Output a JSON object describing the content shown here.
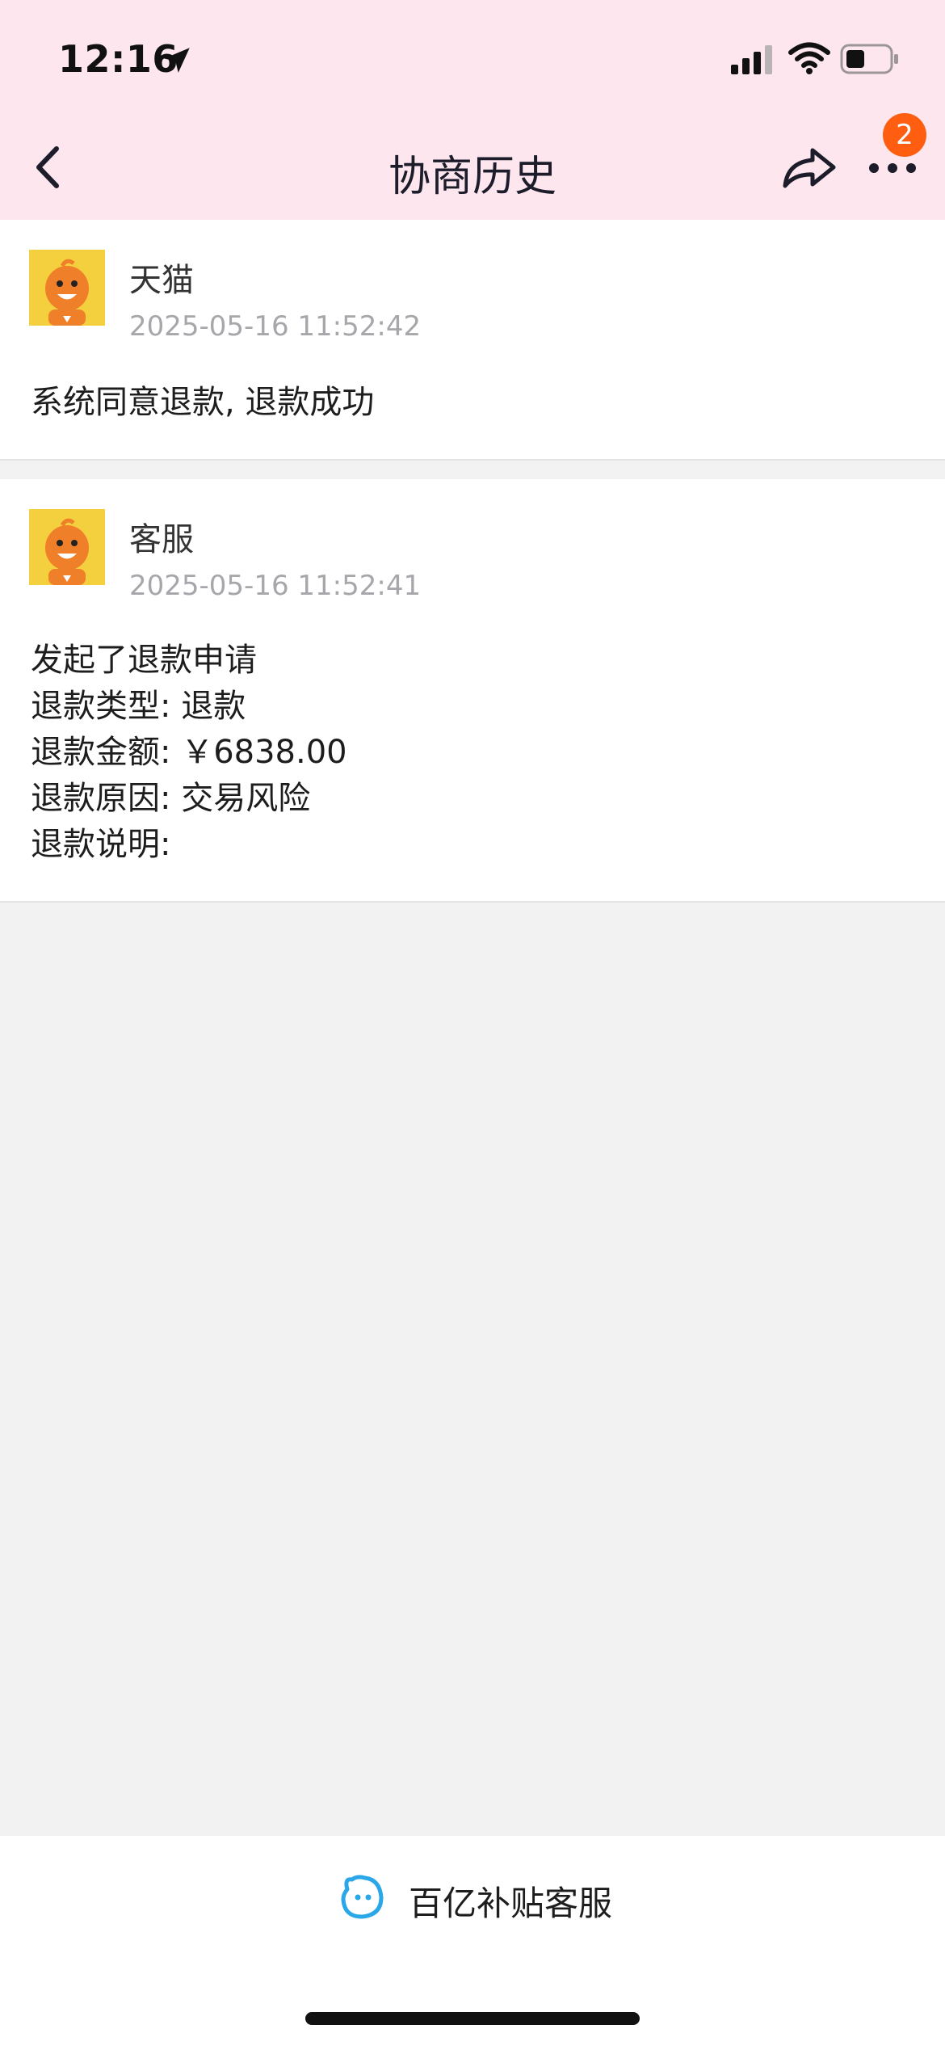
{
  "status_bar": {
    "time": "12:16",
    "icons": [
      "location-arrow-icon",
      "signal-icon",
      "wifi-icon",
      "battery-icon"
    ]
  },
  "nav": {
    "title": "协商历史",
    "badge_count": "2",
    "icons": [
      "back-icon",
      "share-icon",
      "more-icon"
    ]
  },
  "records": [
    {
      "author": "天猫",
      "timestamp": "2025-05-16 11:52:42",
      "lines": [
        "系统同意退款, 退款成功"
      ]
    },
    {
      "author": "客服",
      "timestamp": "2025-05-16 11:52:41",
      "lines": [
        "发起了退款申请",
        "退款类型: 退款",
        "退款金额: ￥6838.00",
        "退款原因: 交易风险",
        "退款说明:"
      ]
    }
  ],
  "footer": {
    "service_label": "百亿补贴客服"
  },
  "colors": {
    "header_bg": "#fde6ee",
    "badge": "#ff5d0f",
    "page_bg": "#f2f2f3",
    "service_icon": "#2aa7e8"
  }
}
